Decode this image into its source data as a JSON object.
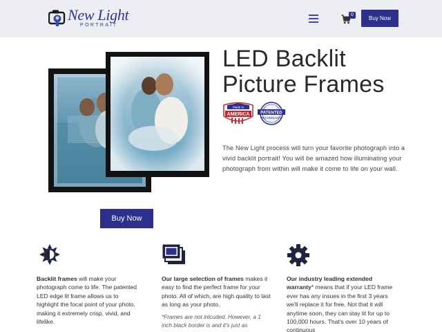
{
  "header": {
    "logo_text": "New Light",
    "logo_subtext": "PORTRAIT",
    "cart_count": "0",
    "buy_label": "Buy Now",
    "icons": [
      "camera-logo-icon",
      "menu-icon",
      "cart-icon"
    ]
  },
  "hero": {
    "title_line1": "LED Backlit",
    "title_line2": "Picture Frames",
    "badge_america": {
      "top": "Made in",
      "main": "AMERICA"
    },
    "badge_patent": {
      "line1": "PATENTED",
      "line2": "TECHNOLOGY"
    },
    "description": "The New Light process will turn your favorite photograph into a vivid backlit portrait! You will be amazed how illuminating your photograph from within will make it come to life on your wall.",
    "buy_label": "Buy Now"
  },
  "features": [
    {
      "icon": "brightness-icon",
      "bold": "Backlit frames",
      "text": " will make your photograph come to life. The patented LED edge lit frame allows us to highlight the focal point of your photo, making it extremely crisp, vivid, and lifelike."
    },
    {
      "icon": "frames-stack-icon",
      "bold": "Our large selection of frames",
      "text": " makes it easy to find the perfect frame for your photo. All of which, are high quality to last as long as your photo.",
      "note": "*Frames are not inlcuded. However, a 1 inch black border is and it's just as"
    },
    {
      "icon": "gear-icon",
      "bold": "Our industry leading extended warranty",
      "text": "* means that if your LED frame ever has any insues in the first 3 years we'll replace it for free. Not that it will anytime soon, they can stay lit for up to 100,000 hours. That's over 10 years of continuous"
    }
  ],
  "colors": {
    "brand": "#2c2f8c",
    "header_bg": "#eceef3",
    "badge_red": "#c0282d"
  }
}
